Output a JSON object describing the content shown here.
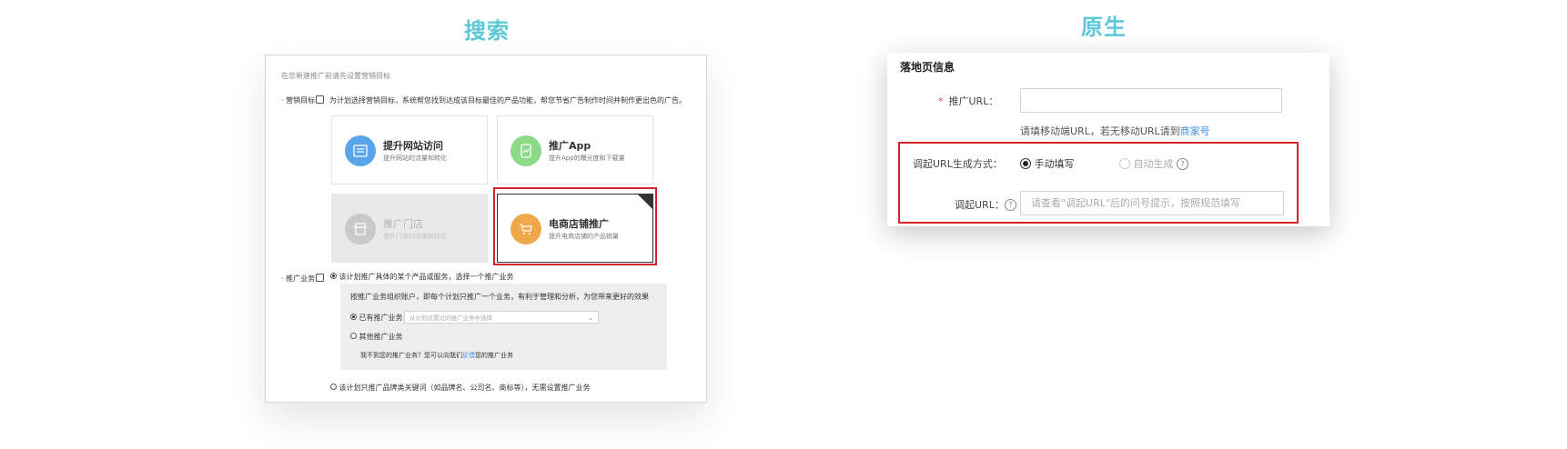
{
  "titles": {
    "left": "搜索",
    "right": "原生"
  },
  "left": {
    "heading": "在您新建推广前请先设置营销目标",
    "goal_label": "营销目标",
    "goal_desc": "为计划选择营销目标，系统帮您找到达成该目标最佳的产品功能，帮您节省广告制作时间并制作更出色的广告。",
    "cards": [
      {
        "title": "提升网站访问",
        "sub": "提升网站的流量和转化",
        "icon": "website-icon",
        "color": "#5aa4ea"
      },
      {
        "title": "推广App",
        "sub": "提升App的曝光度和下载量",
        "icon": "app-icon",
        "color": "#8cd98a"
      },
      {
        "title": "推广门店",
        "sub": "提升门店的流量和转化",
        "icon": "store-icon",
        "color": "#c9c9c9"
      },
      {
        "title": "电商店铺推广",
        "sub": "提升电商店铺的产品销量",
        "icon": "cart-icon",
        "color": "#f0a94a"
      }
    ],
    "business_label": "推广业务",
    "business_opt1": "该计划推广具体的某个产品或服务，选择一个推广业务",
    "box_desc": "按推广业务组织账户，即每个计划只推广一个业务，有利于管理和分析，为您带来更好的效果",
    "existing_label": "已有推广业务",
    "select_placeholder": "从计划设置过的推广业务中选择",
    "other_label": "其他推广业务",
    "feedback_prefix": "我不到您的推广业务？您可以向我们",
    "feedback_link": "反馈",
    "feedback_suffix": "您的推广业务",
    "business_opt2": "该计划只推广品牌类关键词（如品牌名、公司名、商标等），无需设置推广业务"
  },
  "right": {
    "title": "落地页信息",
    "url_label": "推广URL：",
    "url_value": "",
    "hint_prefix": "请填移动端URL，若无移动URL请到",
    "hint_link": "商家号",
    "gen_label": "调起URL生成方式：",
    "gen_opt1": "手动填写",
    "gen_opt2": "自动生成",
    "invoke_label": "调起URL：",
    "invoke_placeholder": "请查看\"调起URL\"后的问号提示，按照规范填写"
  },
  "colors": {
    "title": "#5ec8d8",
    "highlight": "#d4252c",
    "link": "#3a8ee6",
    "required": "#e24a4a"
  }
}
